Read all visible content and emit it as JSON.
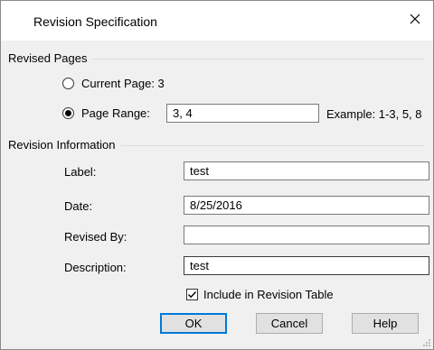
{
  "dialog": {
    "title": "Revision Specification"
  },
  "revised_pages": {
    "group_label": "Revised Pages",
    "current_page_label": "Current Page: 3",
    "page_range_label": "Page Range:",
    "page_range_value": "3, 4",
    "example_text": "Example: 1-3, 5, 8",
    "selected": "page_range"
  },
  "revision_info": {
    "group_label": "Revision Information",
    "label_label": "Label:",
    "label_value": "test",
    "date_label": "Date:",
    "date_value": "8/25/2016",
    "revised_by_label": "Revised By:",
    "revised_by_value": "",
    "description_label": "Description:",
    "description_value": "test",
    "include_label": "Include in Revision Table",
    "include_checked": true
  },
  "buttons": {
    "ok": "OK",
    "cancel": "Cancel",
    "help": "Help"
  },
  "icons": {
    "close": "close-icon",
    "checkmark": "checkmark-icon",
    "resize_grip": "resize-grip-icon"
  },
  "colors": {
    "accent": "#0078d7"
  }
}
